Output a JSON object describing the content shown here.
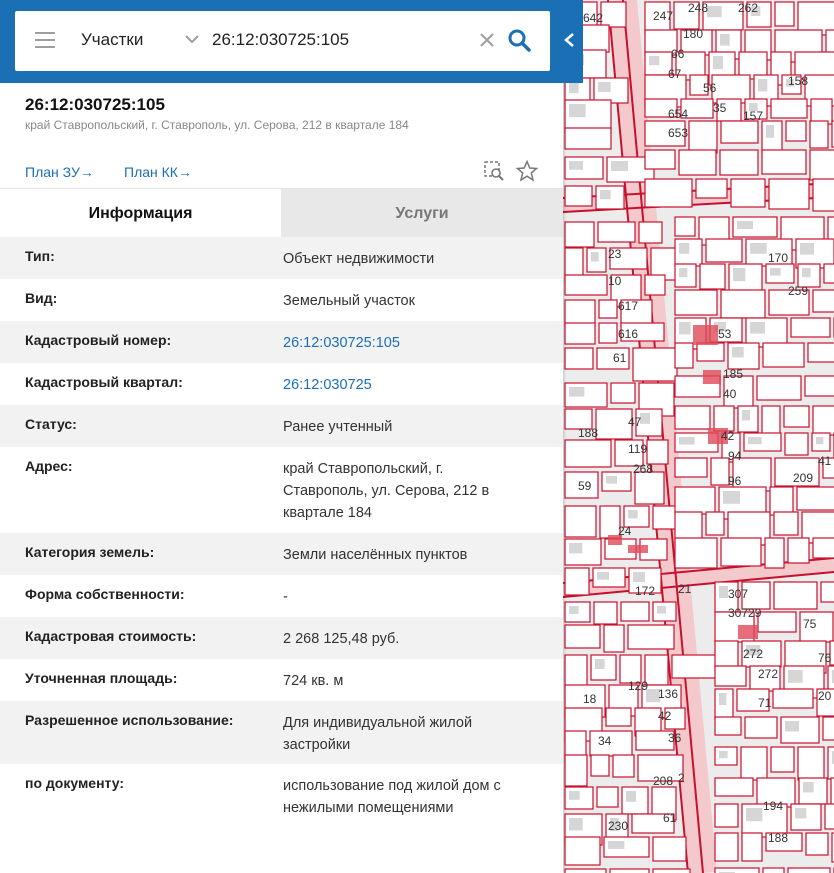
{
  "search": {
    "type_label": "Участки",
    "value": "26:12:030725:105"
  },
  "object": {
    "title": "26:12:030725:105",
    "address": "край Ставропольский, г. Ставрополь, ул. Серова, 212 в квартале 184"
  },
  "links": {
    "plan_zu": "План ЗУ→",
    "plan_kk": "План КК→"
  },
  "tabs": [
    {
      "label": "Информация",
      "active": true
    },
    {
      "label": "Услуги",
      "active": false
    }
  ],
  "info_rows": [
    {
      "label": "Тип:",
      "value": "Объект недвижимости"
    },
    {
      "label": "Вид:",
      "value": "Земельный участок"
    },
    {
      "label": "Кадастровый номер:",
      "value": "26:12:030725:105",
      "link": true
    },
    {
      "label": "Кадастровый квартал:",
      "value": "26:12:030725",
      "link": true
    },
    {
      "label": "Статус:",
      "value": "Ранее учтенный"
    },
    {
      "label": "Адрес:",
      "value": "край Ставропольский, г. Ставрополь, ул. Серова, 212 в квартале 184"
    },
    {
      "label": "Категория земель:",
      "value": "Земли населённых пунктов"
    },
    {
      "label": "Форма собственности:",
      "value": "-"
    },
    {
      "label": "Кадастровая стоимость:",
      "value": "2 268 125,48 руб."
    },
    {
      "label": "Уточненная площадь:",
      "value": "724 кв. м"
    },
    {
      "label": "Разрешенное использование:",
      "value": "Для индивидуальной жилой застройки"
    },
    {
      "label": "по документу:",
      "value": "использование под жилой дом с нежилыми помещениями"
    }
  ],
  "map_labels": [
    "642",
    "247",
    "248",
    "262",
    "180",
    "66",
    "67",
    "56",
    "654",
    "35",
    "653",
    "157",
    "158",
    "170",
    "259",
    "23",
    "10",
    "617",
    "616",
    "61",
    "53",
    "185",
    "40",
    "42",
    "94",
    "96",
    "47",
    "119",
    "268",
    "188",
    "59",
    "41",
    "209",
    "24",
    "172",
    "21",
    "307",
    "30729",
    "272",
    "272",
    "71",
    "18",
    "129",
    "136",
    "42",
    "36",
    "34",
    "208",
    "2",
    "230",
    "61",
    "194",
    "188",
    "75",
    "76",
    "20",
    "109",
    "1"
  ],
  "colors": {
    "accent": "#1a6fb5",
    "cadastral_line": "#c8102e",
    "parcel_fill": "#e04a5a"
  }
}
